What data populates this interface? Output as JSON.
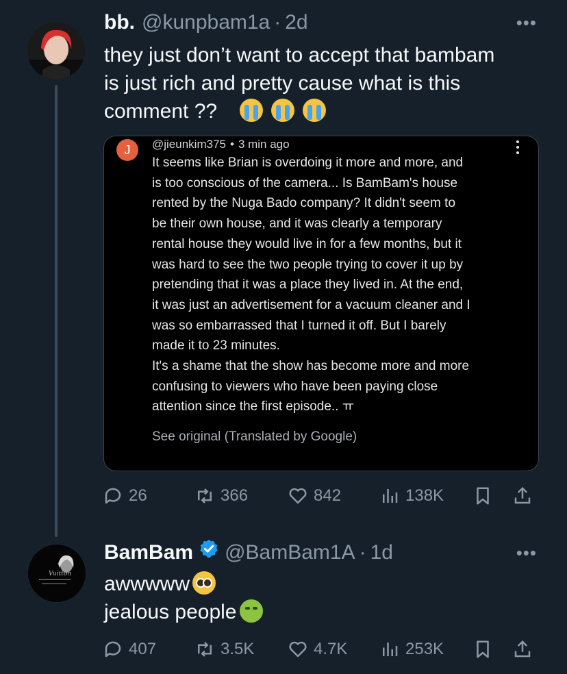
{
  "tweet1": {
    "display_name": "bb.",
    "handle": "@kunpbam1a",
    "time": "2d",
    "text_line1": "they just don’t want to accept that bambam",
    "text_line2": "is just rich and pretty cause what is this",
    "text_line3": "comment ??",
    "quote": {
      "avatar_letter": "J",
      "handle": "@jieunkim375",
      "time": "3 min ago",
      "body": "It seems like Brian is overdoing it more and more, and\nis too conscious of the camera... Is BamBam's house\nrented by the Nuga Bado company? It didn't seem to\nbe their own house, and it was clearly a temporary\nrental house they would live in for a few months, but it\nwas hard to see the two people trying to cover it up by\npretending that it was a place they lived in. At the end,\nit was just an advertisement for a vacuum cleaner and I\nwas so embarrassed that I turned it off. But I barely\nmade it to 23 minutes.\nIt's a shame that the show has become more and more\nconfusing to viewers who have been paying close\nattention since the first episode.. ㅠ",
      "see_original": "See original (Translated by Google)"
    },
    "replies": "26",
    "retweets": "366",
    "likes": "842",
    "views": "138K"
  },
  "tweet2": {
    "display_name": "BamBam",
    "handle": "@BamBam1A",
    "time": "1d",
    "text_line1": "awwwww",
    "text_line2": "jealous people",
    "replies": "407",
    "retweets": "3.5K",
    "likes": "4.7K",
    "views": "253K"
  },
  "colors": {
    "background": "#15202b",
    "secondary_text": "#8b98a5",
    "verified": "#1d9bf0"
  },
  "icons": {
    "reply": "reply-icon",
    "retweet": "retweet-icon",
    "like": "heart-icon",
    "views": "views-icon",
    "bookmark": "bookmark-icon",
    "share": "share-icon"
  }
}
